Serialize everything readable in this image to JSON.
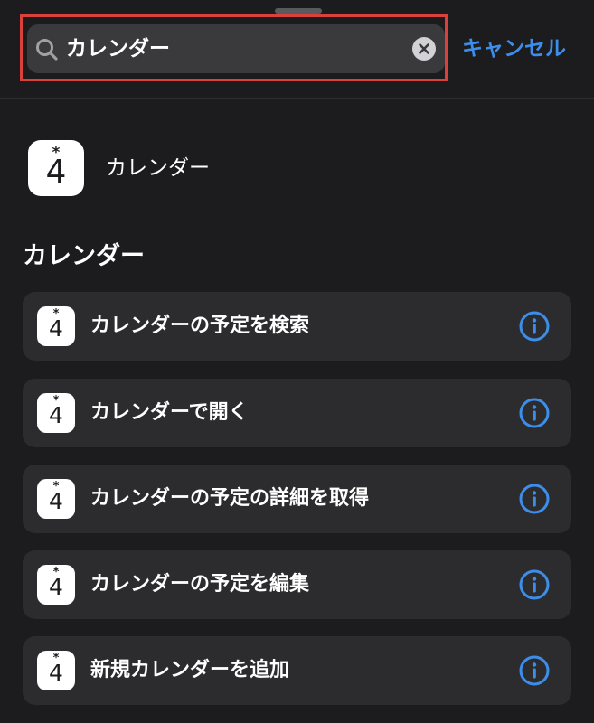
{
  "search": {
    "query": "カレンダー",
    "cancel_label": "キャンセル"
  },
  "app_result": {
    "icon_star": "*",
    "icon_day": "4",
    "label": "カレンダー"
  },
  "section": {
    "title": "カレンダー"
  },
  "actions": [
    {
      "label": "カレンダーの予定を検索"
    },
    {
      "label": "カレンダーで開く"
    },
    {
      "label": "カレンダーの予定の詳細を取得"
    },
    {
      "label": "カレンダーの予定を編集"
    },
    {
      "label": "新規カレンダーを追加"
    }
  ],
  "colors": {
    "background": "#1c1c1e",
    "row_background": "#2c2c2e",
    "search_field": "#3a3a3c",
    "accent": "#3d8eea",
    "highlight_border": "#d9413a"
  },
  "icons": {
    "search": "search-icon",
    "clear": "clear-icon",
    "info": "info-icon",
    "app": "calendar-app-icon"
  }
}
